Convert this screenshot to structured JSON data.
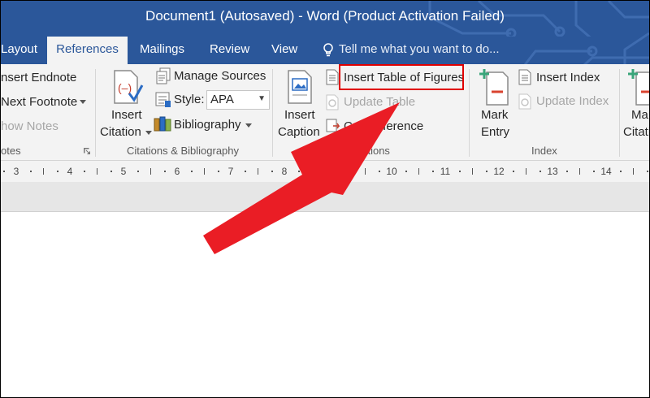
{
  "window": {
    "title": "Document1 (Autosaved) - Word (Product Activation Failed)"
  },
  "tabs": [
    {
      "label": "Layout",
      "active": false
    },
    {
      "label": "References",
      "active": true
    },
    {
      "label": "Mailings",
      "active": false
    },
    {
      "label": "Review",
      "active": false
    },
    {
      "label": "View",
      "active": false
    }
  ],
  "tell_me": {
    "text": "Tell me what you want to do..."
  },
  "footnotes": {
    "insert_endnote": "nsert Endnote",
    "next_footnote": "Next Footnote",
    "show_notes": "how Notes",
    "group_label": "otes"
  },
  "citations": {
    "insert_citation_line1": "Insert",
    "insert_citation_line2": "Citation",
    "manage_sources": "Manage Sources",
    "style_label": "Style:",
    "style_value": "APA",
    "bibliography": "Bibliography",
    "group_label": "Citations & Bibliography"
  },
  "captions": {
    "insert_caption_line1": "Insert",
    "insert_caption_line2": "Caption",
    "insert_table_of_figures": "Insert Table of Figures",
    "update_table": "Update Table",
    "cross_reference_prefix": "Cr",
    "cross_reference_suffix": "eference",
    "group_label": "aptions"
  },
  "index": {
    "mark_entry_line1": "Mark",
    "mark_entry_line2": "Entry",
    "insert_index": "Insert Index",
    "update_index": "Update Index",
    "group_label": "Index"
  },
  "table_of_authorities": {
    "mark_citation_line1": "Ma",
    "mark_citation_line2": "Citati"
  },
  "ruler": {
    "numbers": [
      "3",
      "4",
      "5",
      "6",
      "7",
      "8",
      "9",
      "10",
      "11",
      "12",
      "13",
      "14"
    ]
  },
  "colors": {
    "title_bar": "#2b579a",
    "ribbon": "#f3f3f3",
    "highlight": "#e00000",
    "arrow": "#ea1d25"
  }
}
